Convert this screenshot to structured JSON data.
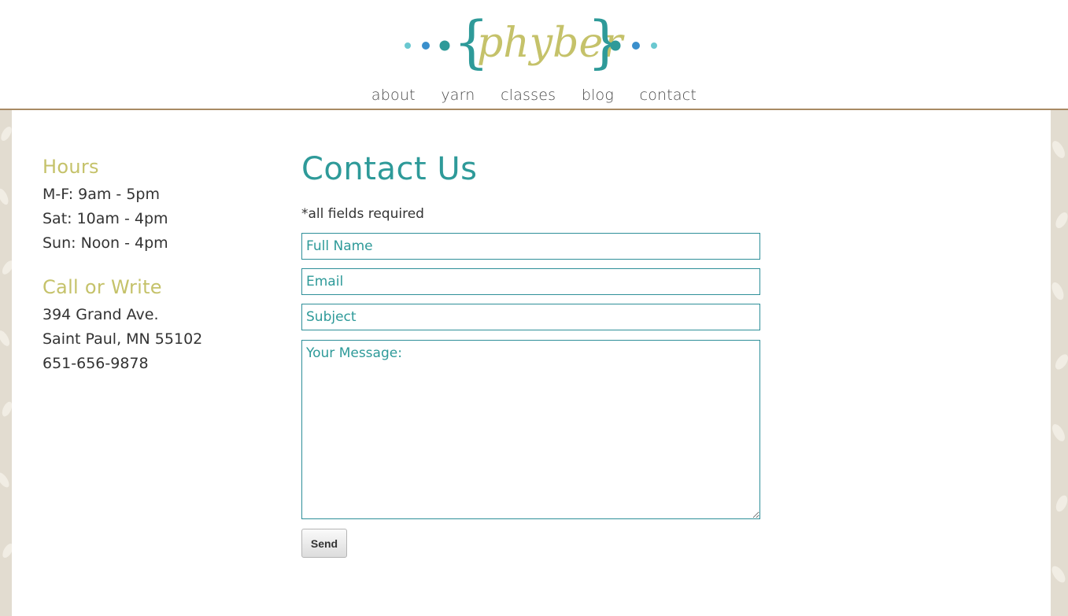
{
  "brand": {
    "logo_text": "phyber",
    "colors": {
      "accent_teal": "#2e9a99",
      "accent_olive": "#c5c26a",
      "dot_blue": "#3a8fcc",
      "dot_light": "#6ac8d0",
      "border_brown": "#a88a64"
    }
  },
  "nav": {
    "items": [
      "about",
      "yarn",
      "classes",
      "blog",
      "contact"
    ]
  },
  "sidebar": {
    "hours_title": "Hours",
    "hours": [
      "M-F: 9am - 5pm",
      "Sat: 10am - 4pm",
      "Sun: Noon - 4pm"
    ],
    "contact_title": "Call or Write",
    "contact": [
      "394 Grand Ave.",
      "Saint Paul, MN 55102",
      "651-656-9878"
    ]
  },
  "form": {
    "title": "Contact Us",
    "required_note": "*all fields required",
    "name_placeholder": "Full Name",
    "email_placeholder": "Email",
    "subject_placeholder": "Subject",
    "message_placeholder": "Your Message:",
    "send_label": "Send"
  }
}
